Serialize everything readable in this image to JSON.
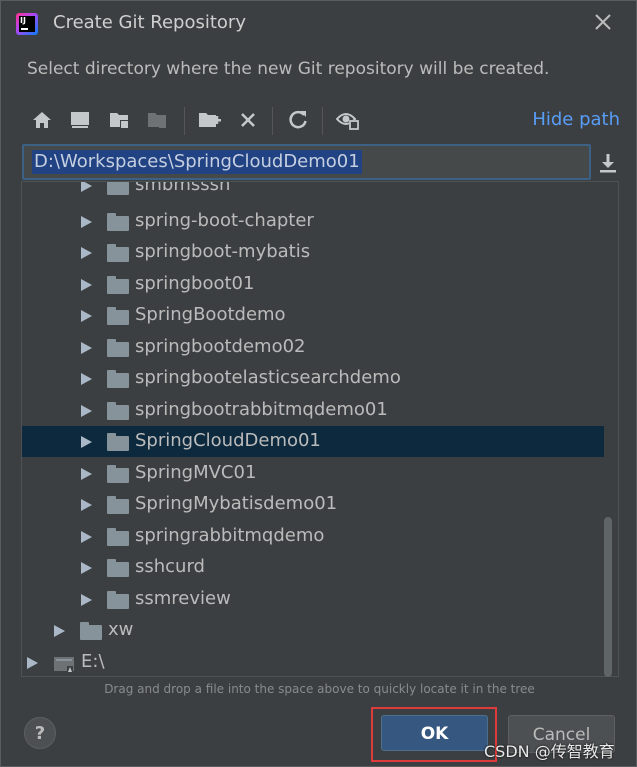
{
  "window": {
    "title": "Create Git Repository",
    "app_icon_text": "IJ"
  },
  "subtitle": "Select directory where the new Git repository will be created.",
  "toolbar": {
    "buttons": [
      "home-icon",
      "desktop-icon",
      "project-folder-icon",
      "module-folder-icon",
      "new-folder-icon",
      "delete-icon",
      "refresh-icon",
      "show-hidden-icon"
    ],
    "hide_path_label": "Hide path"
  },
  "path": {
    "value": "D:\\Workspaces\\SpringCloudDemo01"
  },
  "tree": {
    "partial_top": "smbmsssh",
    "items": [
      {
        "label": "spring-boot-chapter",
        "selected": false
      },
      {
        "label": "springboot-mybatis",
        "selected": false
      },
      {
        "label": "springboot01",
        "selected": false
      },
      {
        "label": "SpringBootdemo",
        "selected": false
      },
      {
        "label": "springbootdemo02",
        "selected": false
      },
      {
        "label": "springbootelasticsearchdemo",
        "selected": false
      },
      {
        "label": "springbootrabbitmqdemo01",
        "selected": false
      },
      {
        "label": "SpringCloudDemo01",
        "selected": true
      },
      {
        "label": "SpringMVC01",
        "selected": false
      },
      {
        "label": "SpringMybatisdemo01",
        "selected": false
      },
      {
        "label": "springrabbitmqdemo",
        "selected": false
      },
      {
        "label": "sshcurd",
        "selected": false
      },
      {
        "label": "ssmreview",
        "selected": false
      }
    ],
    "parent_sibling": "xw",
    "drive": "E:\\"
  },
  "hint": "Drag and drop a file into the space above to quickly locate it in the tree",
  "buttons": {
    "help": "?",
    "ok": "OK",
    "cancel": "Cancel"
  },
  "watermark": "CSDN @传智教育",
  "colors": {
    "background": "#3c3f41",
    "selection": "#0d293e",
    "link": "#589df6",
    "ok_button": "#365880",
    "highlight_box": "#e03b3b"
  }
}
